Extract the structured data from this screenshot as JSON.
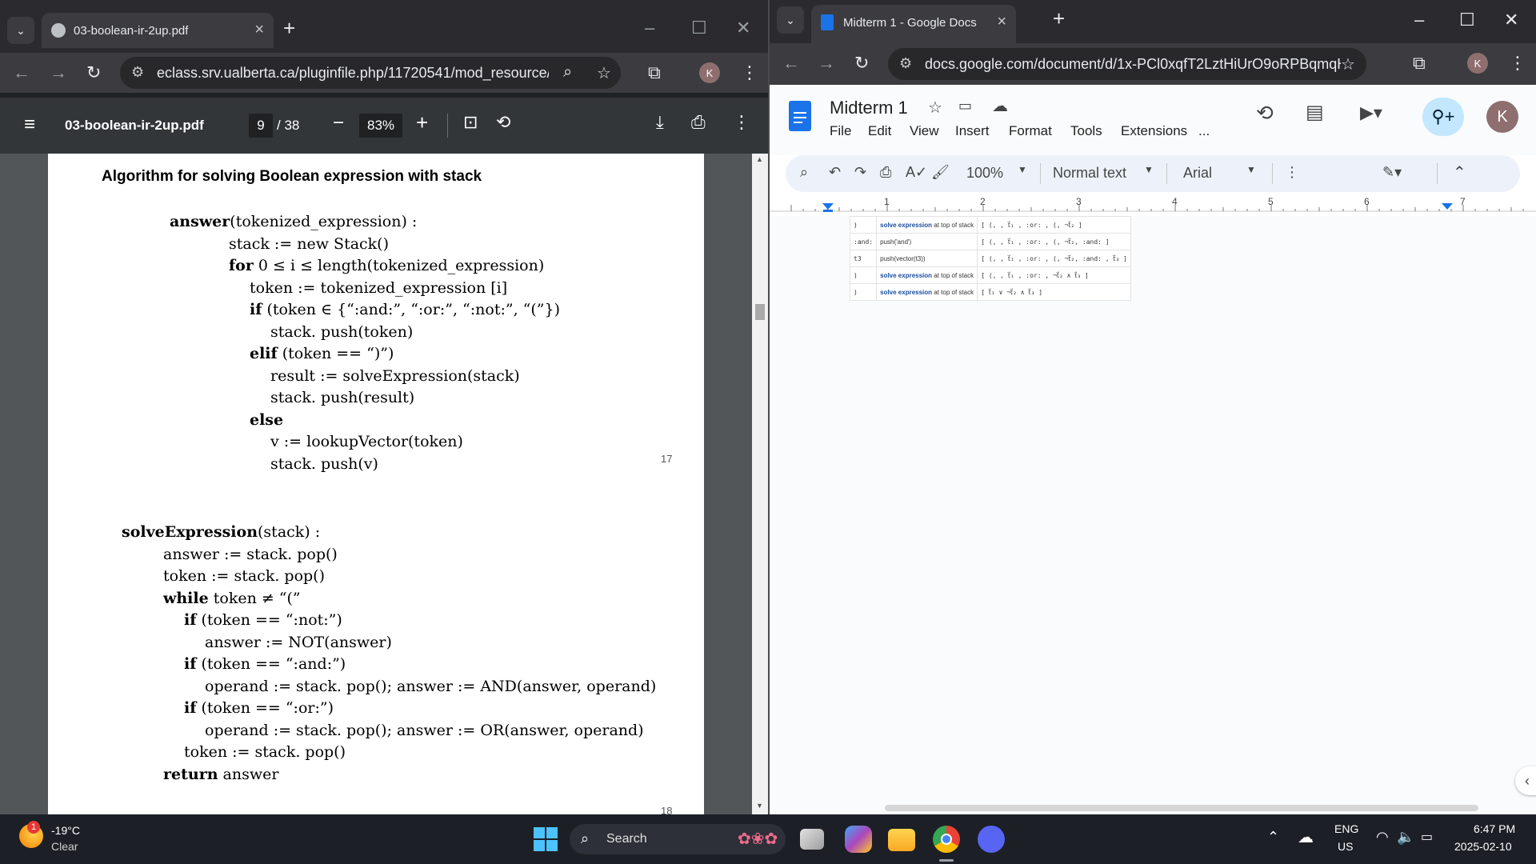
{
  "colors": {
    "chrome_dark": "#2b2b2f",
    "toolbar": "#3b3b40",
    "pdf_bar": "#323639",
    "docs_blue": "#1a73e8",
    "share_blue": "#c2e7ff"
  },
  "pdf_window": {
    "tab_title": "03-boolean-ir-2up.pdf",
    "url": "eclass.srv.ualberta.ca/pluginfile.php/11720541/mod_resource/...",
    "avatar": "K",
    "viewer": {
      "title": "03-boolean-ir-2up.pdf",
      "page": "9",
      "page_total": "/ 38",
      "zoom": "83%"
    },
    "page": {
      "heading": "Algorithm for solving Boolean expression with stack",
      "slide1_number": "17",
      "slide2_number": "18",
      "code1": [
        {
          "kw": "answer",
          "rest": "(tokenized_expression) :"
        },
        {
          "kw": "",
          "rest": "stack := new Stack()"
        },
        {
          "kw": "for",
          "rest": " 0 ≤ i ≤ length(tokenized_expression)"
        },
        {
          "kw": "",
          "rest": "token := tokenized_expression [i]"
        },
        {
          "kw": "if",
          "rest": " (token ∈ {“:and:”, “:or:”, “:not:”, “(”})"
        },
        {
          "kw": "",
          "rest": "stack. push(token)"
        },
        {
          "kw": "elif",
          "rest": " (token == “)”)"
        },
        {
          "kw": "",
          "rest": "result := solveExpression(stack)"
        },
        {
          "kw": "",
          "rest": "stack. push(result)"
        },
        {
          "kw": "else",
          "rest": ""
        },
        {
          "kw": "",
          "rest": "v := lookupVector(token)"
        },
        {
          "kw": "",
          "rest": "stack. push(v)"
        }
      ],
      "code2": [
        {
          "kw": "solveExpression",
          "rest": "(stack) :"
        },
        {
          "kw": "",
          "rest": "answer := stack. pop()"
        },
        {
          "kw": "",
          "rest": "token := stack. pop()"
        },
        {
          "kw": "while",
          "rest": " token ≠ “(”"
        },
        {
          "kw": "if",
          "rest": " (token == “:not:”)"
        },
        {
          "kw": "",
          "rest": "answer := NOT(answer)"
        },
        {
          "kw": "if",
          "rest": " (token == “:and:”)"
        },
        {
          "kw": "",
          "rest": "operand := stack. pop();  answer := AND(answer, operand)"
        },
        {
          "kw": "if",
          "rest": " (token == “:or:”)"
        },
        {
          "kw": "",
          "rest": "operand := stack. pop();  answer := OR(answer, operand)"
        },
        {
          "kw": "",
          "rest": "token := stack. pop()"
        },
        {
          "kw": "return",
          "rest": " answer"
        }
      ]
    }
  },
  "docs_window": {
    "tab_title": "Midterm 1 - Google Docs",
    "url": "docs.google.com/document/d/1x-PCl0xqfT2LztHiUrO9oRPBqmqH...",
    "avatar": "K",
    "doc_title": "Midterm 1",
    "menu": [
      "File",
      "Edit",
      "View",
      "Insert",
      "Format",
      "Tools",
      "Extensions",
      "..."
    ],
    "zoom": "100%",
    "style": "Normal text",
    "font": "Arial",
    "ruler_marks": [
      "1",
      "2",
      "3",
      "4",
      "5",
      "6",
      "7"
    ],
    "table_rows": [
      {
        "c1": ")",
        "c2_blue": "solve expression",
        "c2_rest": " at top of stack",
        "c3": "[ (, , t⃗₁ , :or: , (, ¬t⃗₂ ]"
      },
      {
        "c1": ":and:",
        "c2_blue": "",
        "c2_rest": "push('and')",
        "c3": "[ (, , t⃗₁ , :or: , (, ¬t⃗₂, :and: ]"
      },
      {
        "c1": "t3",
        "c2_blue": "",
        "c2_rest": "push(vector(t3))",
        "c3": "[ (, , t⃗₁ , :or: , (, ¬t⃗₂, :and: , t⃗₃ ]"
      },
      {
        "c1": ")",
        "c2_blue": "solve expression",
        "c2_rest": " at top of stack",
        "c3": "[ (, , t⃗₁ , :or: , ¬t⃗₂ ∧ t⃗₃ ]"
      },
      {
        "c1": ")",
        "c2_blue": "solve expression",
        "c2_rest": " at top of stack",
        "c3": "[ t⃗₁ ∨ ¬t⃗₂ ∧ t⃗₃ ]"
      }
    ]
  },
  "taskbar": {
    "weather_temp": "-19°C",
    "weather_desc": "Clear",
    "weather_badge": "1",
    "search_placeholder": "Search",
    "lang_top": "ENG",
    "lang_bottom": "US",
    "time": "6:47 PM",
    "date": "2025-02-10"
  }
}
